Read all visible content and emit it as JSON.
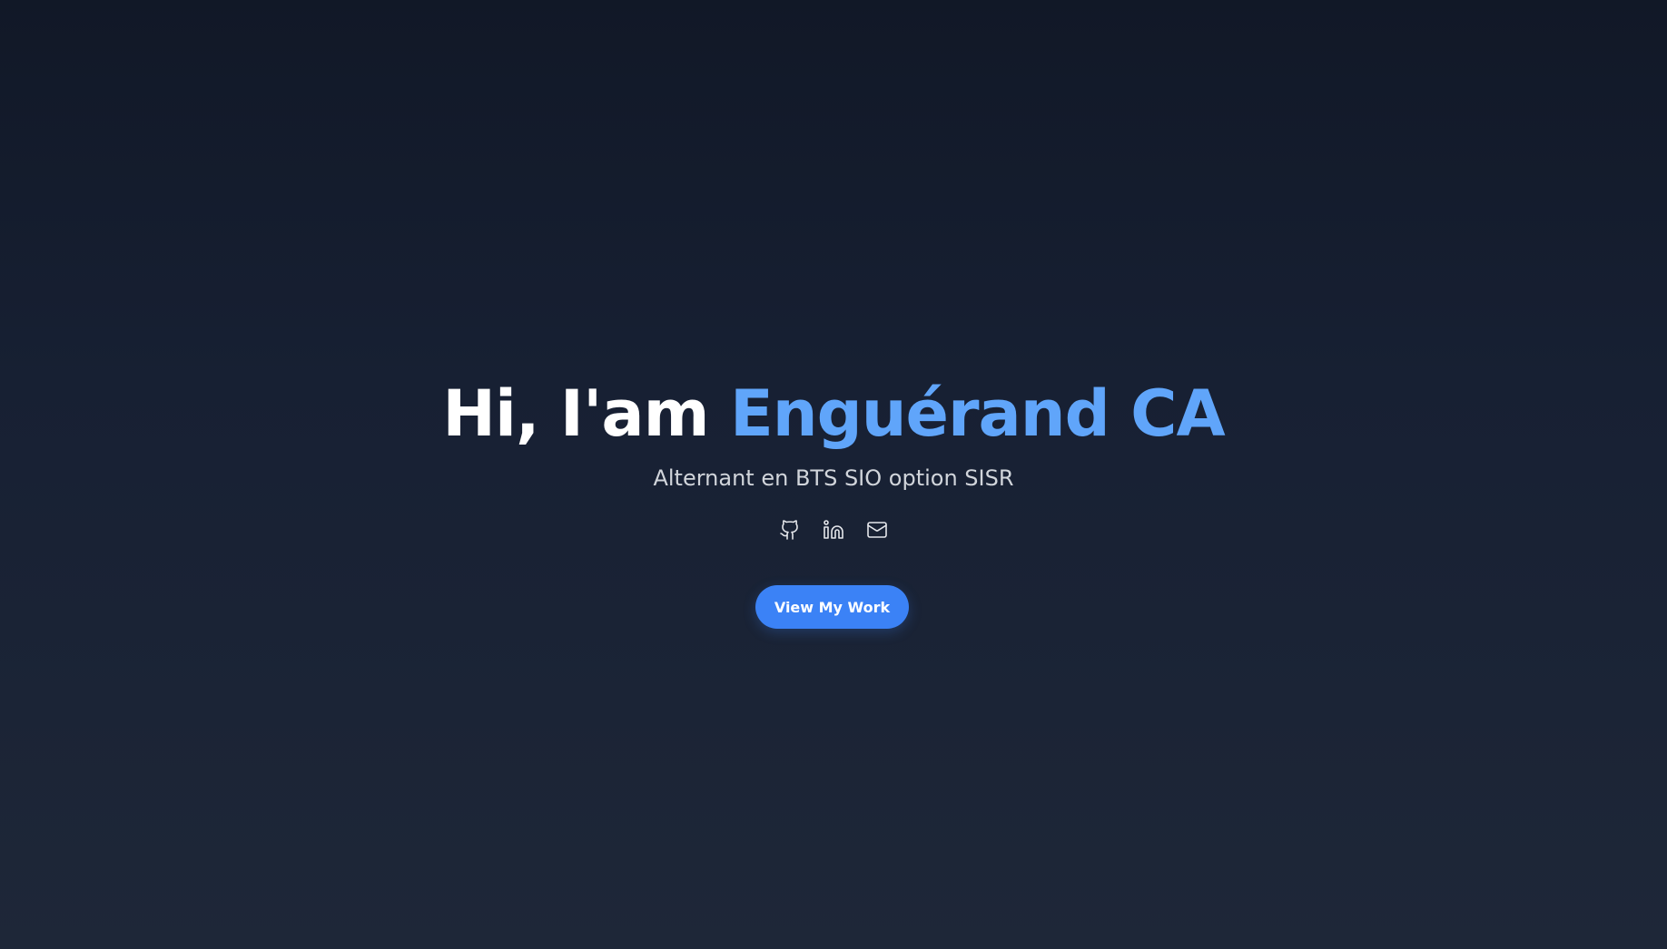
{
  "hero": {
    "greeting": "Hi, I'am ",
    "name": "Enguérand CA",
    "subtitle": "Alternant en BTS SIO option SISR",
    "cta_label": "View My Work"
  },
  "socials": [
    {
      "icon": "github-icon"
    },
    {
      "icon": "linkedin-icon"
    },
    {
      "icon": "mail-icon"
    }
  ],
  "colors": {
    "background_top": "#111827",
    "background_bottom": "#1e2738",
    "accent": "#60a5fa",
    "button": "#3b82f6",
    "subtitle": "#d1d5db"
  }
}
